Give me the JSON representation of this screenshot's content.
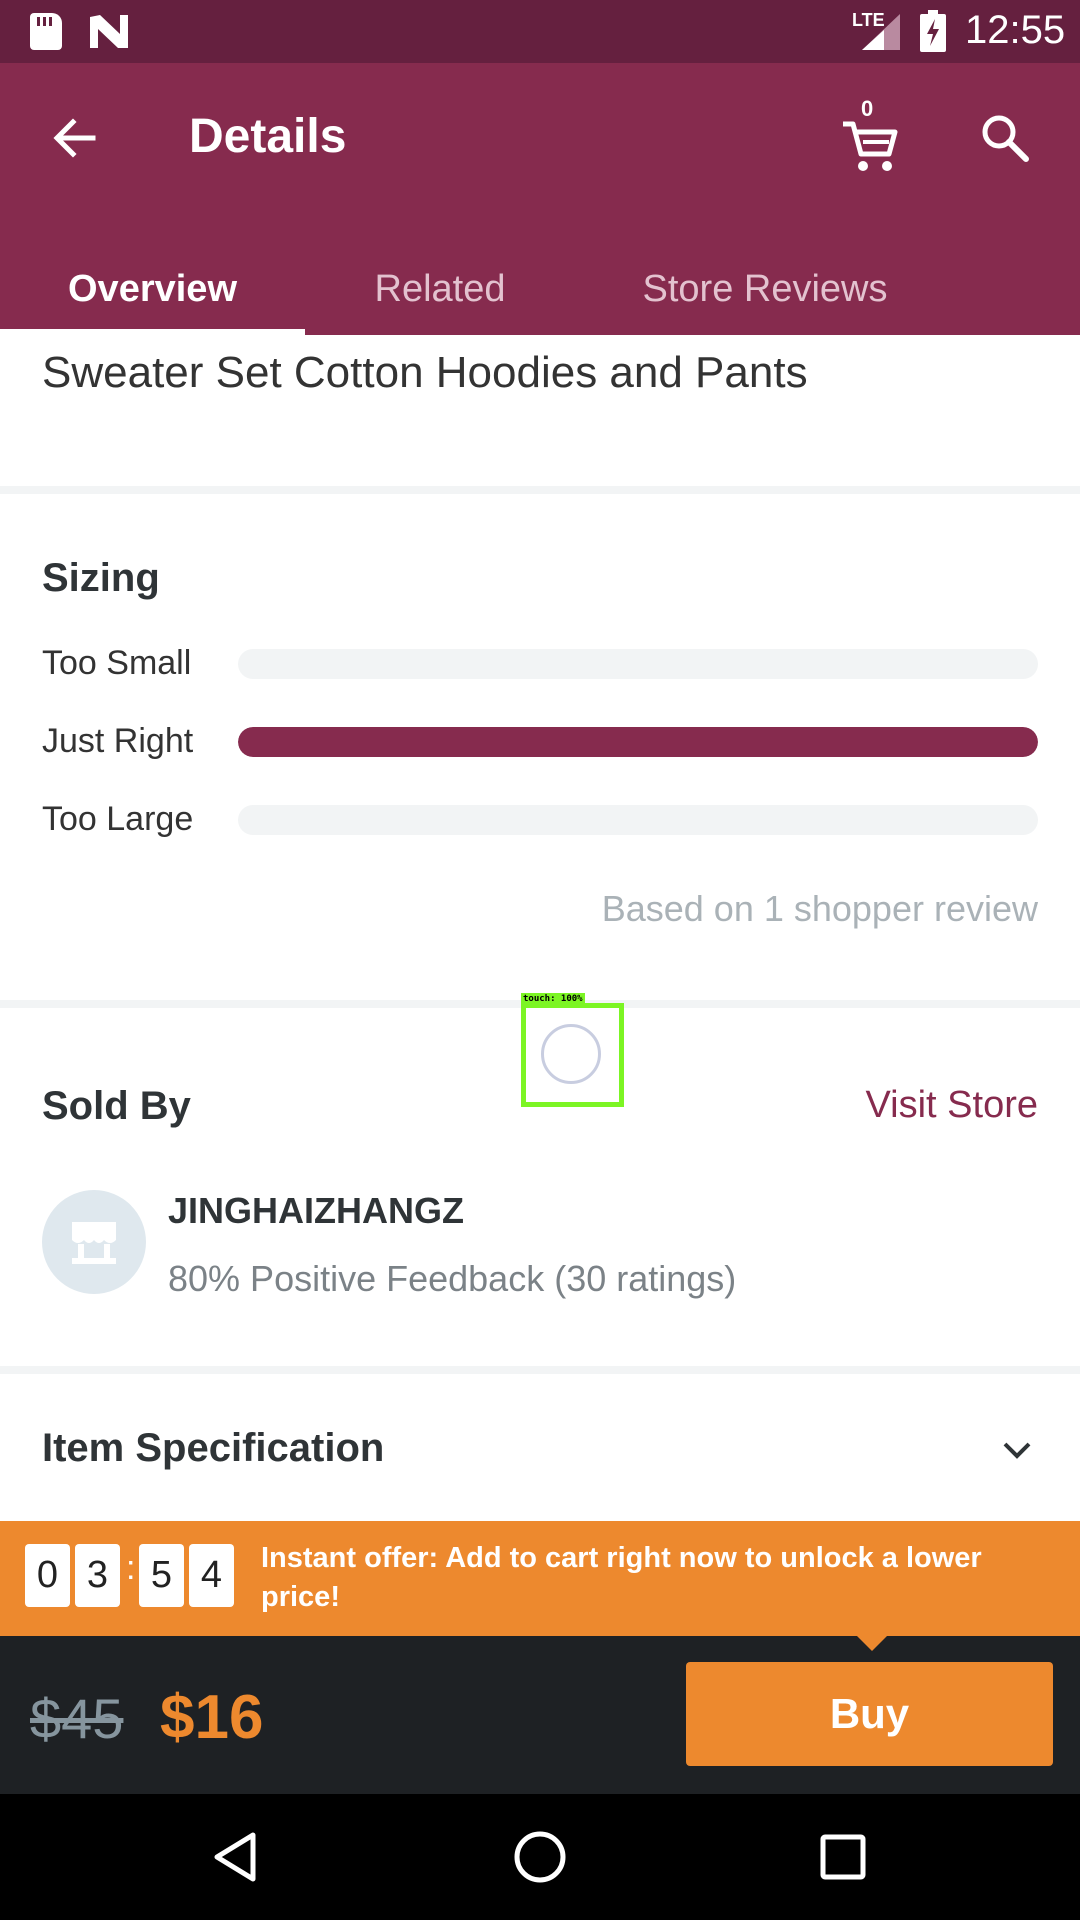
{
  "status_bar": {
    "network_label": "LTE",
    "time": "12:55",
    "icons": [
      "sd-card-icon",
      "n-notification-icon",
      "lte-signal-icon",
      "battery-charging-icon"
    ]
  },
  "app_bar": {
    "title": "Details",
    "cart_count": "0",
    "icons": [
      "back-arrow-icon",
      "cart-icon",
      "search-icon"
    ],
    "color": "#862b4e"
  },
  "tabs": [
    {
      "label": "Overview",
      "active": true
    },
    {
      "label": "Related",
      "active": false
    },
    {
      "label": "Store Reviews",
      "active": false
    }
  ],
  "product": {
    "title": "Sweater Set Cotton Hoodies and Pants"
  },
  "sizing": {
    "title": "Sizing",
    "rows": [
      {
        "label": "Too Small",
        "fraction": 0
      },
      {
        "label": "Just Right",
        "fraction": 1
      },
      {
        "label": "Too Large",
        "fraction": 0
      }
    ],
    "note": "Based on 1 shopper review"
  },
  "seller": {
    "section_title": "Sold By",
    "visit_label": "Visit Store",
    "name": "JINGHAIZHANGZ",
    "feedback": "80% Positive Feedback (30 ratings)",
    "avatar_icon": "storefront-icon"
  },
  "item_spec": {
    "title": "Item Specification",
    "icon": "chevron-down-icon"
  },
  "offer": {
    "timer_digits": [
      "0",
      "3",
      "5",
      "4"
    ],
    "separator": ":",
    "text": "Instant offer: Add to cart right now to unlock a lower price!",
    "color": "#ed892e"
  },
  "price_bar": {
    "old_price": "$45",
    "new_price": "$16",
    "buy_label": "Buy"
  },
  "overlay": {
    "touch_label": "touch: 100%"
  },
  "nav_bar": {
    "icons": [
      "back-triangle-icon",
      "home-circle-icon",
      "recents-square-icon"
    ]
  }
}
